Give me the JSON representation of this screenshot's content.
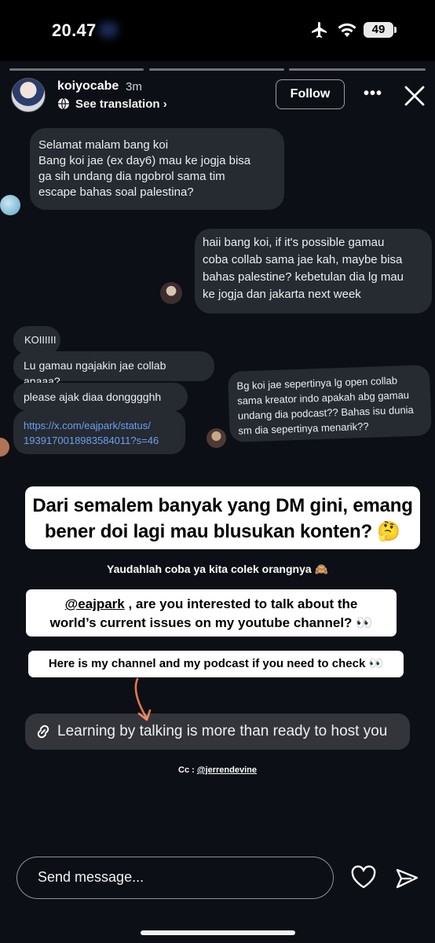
{
  "status_bar": {
    "time": "20.47",
    "battery": "49"
  },
  "story_progress": {
    "segments": 3
  },
  "header": {
    "username": "koiyocabe",
    "age": "3m",
    "translate": "See translation",
    "follow": "Follow"
  },
  "screenshot_dm": {
    "msg1": [
      "Selamat malam bang koi",
      "Bang koi jae (ex day6) mau ke jogja bisa",
      "ga sih undang dia ngobrol sama tim",
      "escape bahas soal palestina?"
    ],
    "msg2": [
      "haii bang koi, if it's possible gamau",
      "coba collab sama jae kah, maybe bisa",
      "bahas palestine? kebetulan dia lg mau",
      "ke jogja dan jakarta next week"
    ],
    "msg3": "KOIIIIII",
    "msg4": "Lu gamau ngajakin jae collab apaaa?",
    "msg5": "please ajak diaa dongggghh",
    "link": [
      "https://x.com/eajpark/status/",
      "1939170018983584011?s=46"
    ],
    "msg6": [
      "Bg koi jae sepertinya lg open collab",
      "sama kreator indo apakah abg gamau",
      "undang dia podcast?? Bahas isu dunia",
      "sm dia sepertinya menarik??"
    ]
  },
  "story_text": {
    "headline_line1": "Dari semalem banyak yang DM gini, emang",
    "headline_line2": "bener doi lagi mau blusukan konten? 🤔",
    "note": "Yaudahlah coba ya kita colek orangnya 🙈",
    "mention": "@eajpark",
    "question_rest": " , are you interested to talk about the",
    "question_line2": "world’s current issues on my youtube channel? 👀",
    "channel_note": "Here is my channel and my podcast if you need to check 👀",
    "link_sticker": "Learning by talking is more than ready to host you",
    "cc_label": "Cc : ",
    "cc_handle": "@jerrendevine"
  },
  "reply": {
    "placeholder": "Send message..."
  },
  "colors": {
    "background": "#0c0f15",
    "bubble": "#262a31",
    "link": "#6b9ff2",
    "arrow": "#e8774a"
  }
}
